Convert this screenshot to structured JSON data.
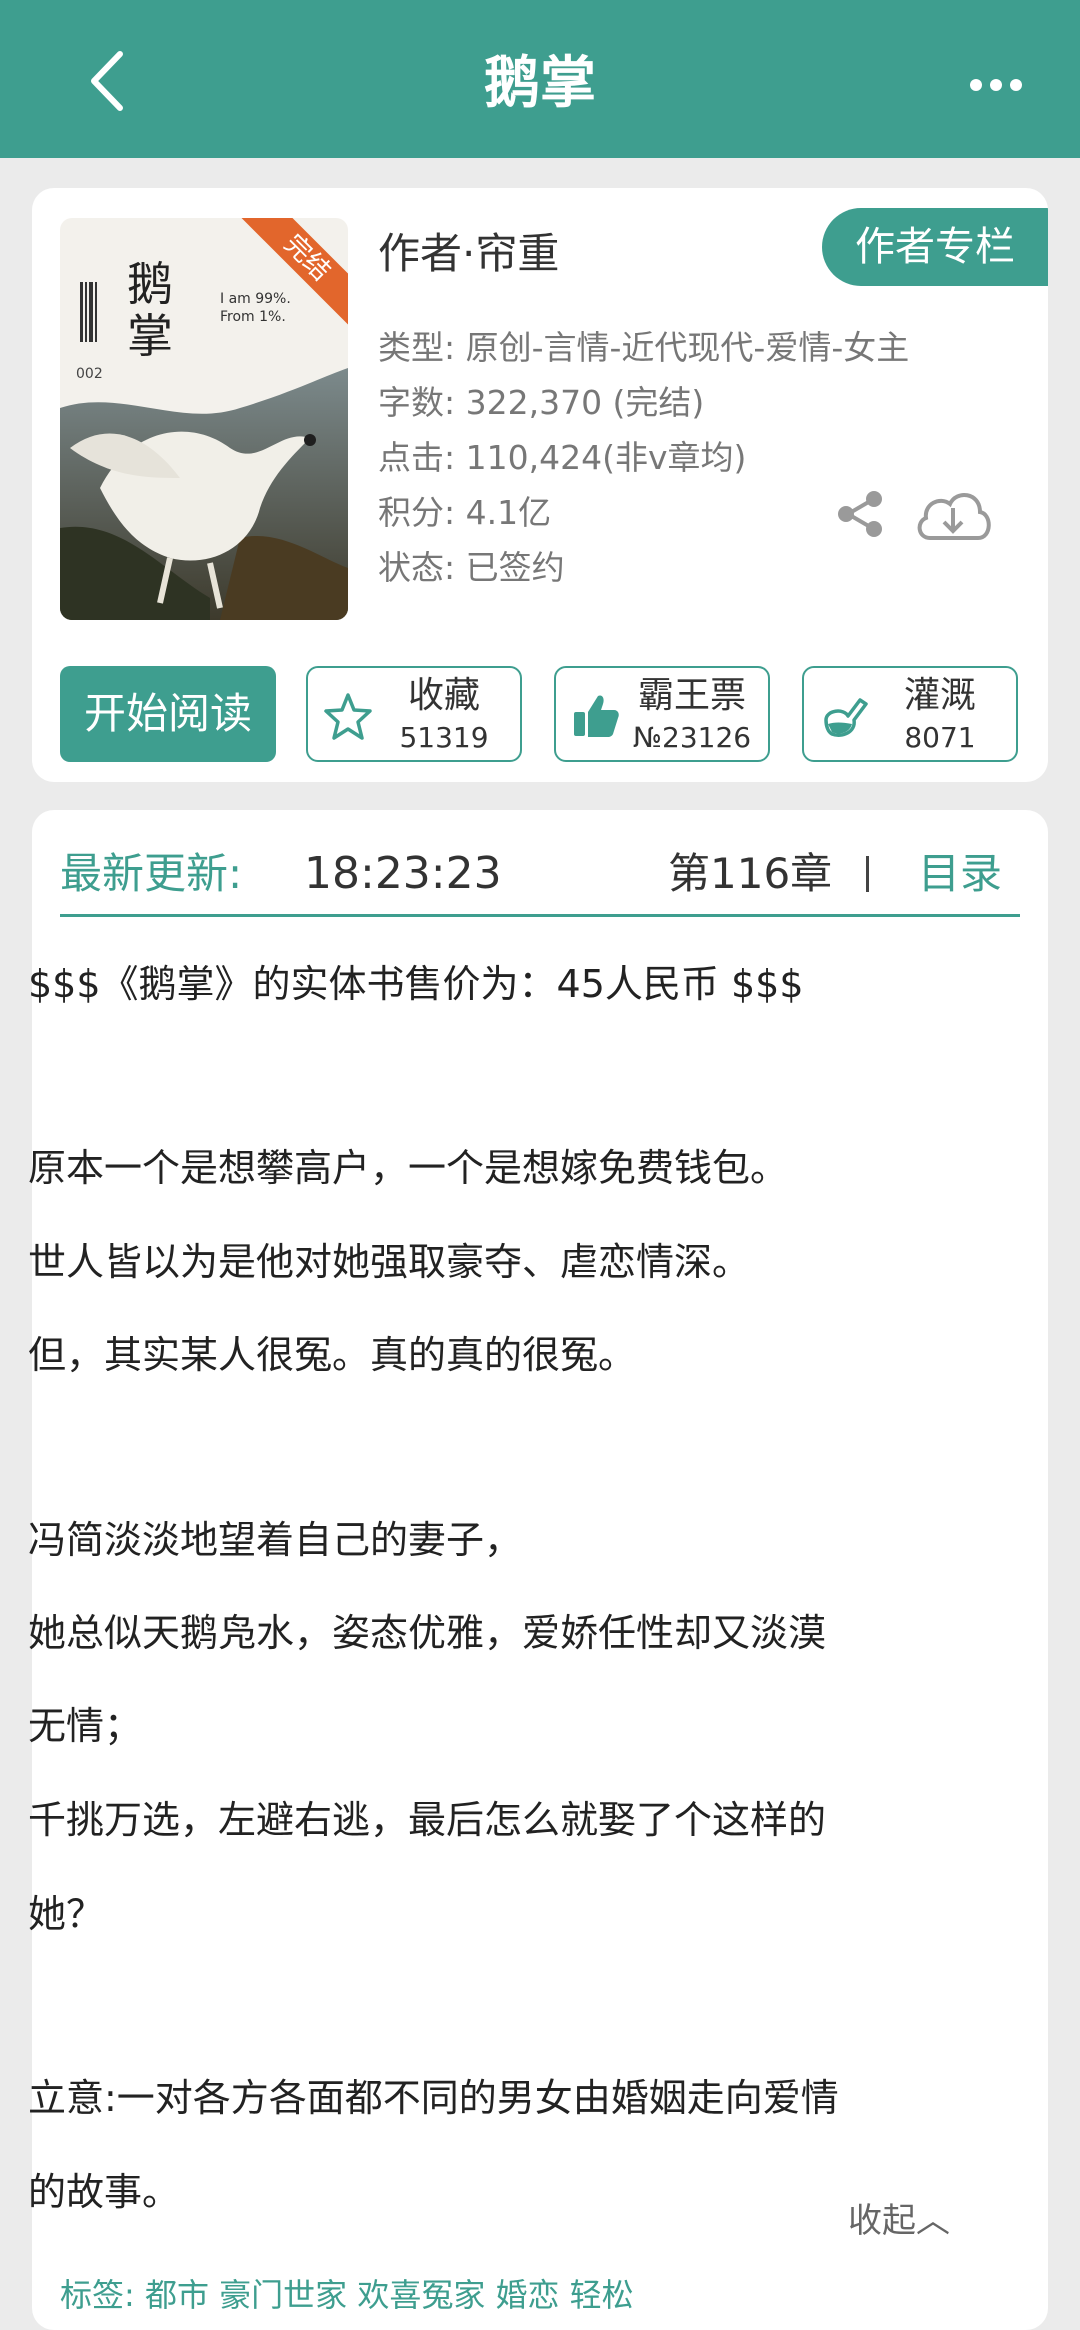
{
  "header": {
    "title": "鹅掌",
    "back_icon": "chevron-left-icon",
    "more_icon": "more-horizontal-icon"
  },
  "book": {
    "cover": {
      "title_line1": "鹅",
      "title_line2": "掌",
      "number": "002",
      "subtitle_line1": "I am 99%.",
      "subtitle_line2": "From 1%.",
      "ribbon": "完结"
    },
    "author": "作者·帘重",
    "author_column_label": "作者专栏",
    "info": [
      "类型: 原创-言情-近代现代-爱情-女主",
      "字数: 322,370 (完结)",
      "点击: 110,424(非v章均)",
      "积分: 4.1亿",
      "状态: 已签约"
    ],
    "start_label": "开始阅读",
    "favorite": {
      "label": "收藏",
      "count": "51319"
    },
    "vote": {
      "label": "霸王票",
      "count": "№23126"
    },
    "irrigate": {
      "label": "灌溉",
      "count": "8071"
    }
  },
  "latest": {
    "label": "最新更新:",
    "time": "18:23:23",
    "chapter": "第116章",
    "toc_label": "目录"
  },
  "description": [
    "$$$《鹅掌》的实体书售价为：45人民币 $$$",
    "原本一个是想攀高户，一个是想嫁免费钱包。",
    "世人皆以为是他对她强取豪夺、虐恋情深。",
    "但，其实某人很冤。真的真的很冤。",
    "冯简淡淡地望着自己的妻子，",
    "她总似天鹅凫水，姿态优雅，爱娇任性却又淡漠",
    "无情；",
    "千挑万选，左避右逃，最后怎么就娶了个这样的",
    "她？",
    "立意:一对各方各面都不同的男女由婚姻走向爱情",
    "的故事。"
  ],
  "collapse_label": "收起︿",
  "tags_label": "标签:",
  "tags": "都市 豪门世家 欢喜冤家 婚恋 轻松",
  "colors": {
    "accent": "#3e9e8f",
    "background": "#ebebeb",
    "ribbon": "#e2662c"
  }
}
